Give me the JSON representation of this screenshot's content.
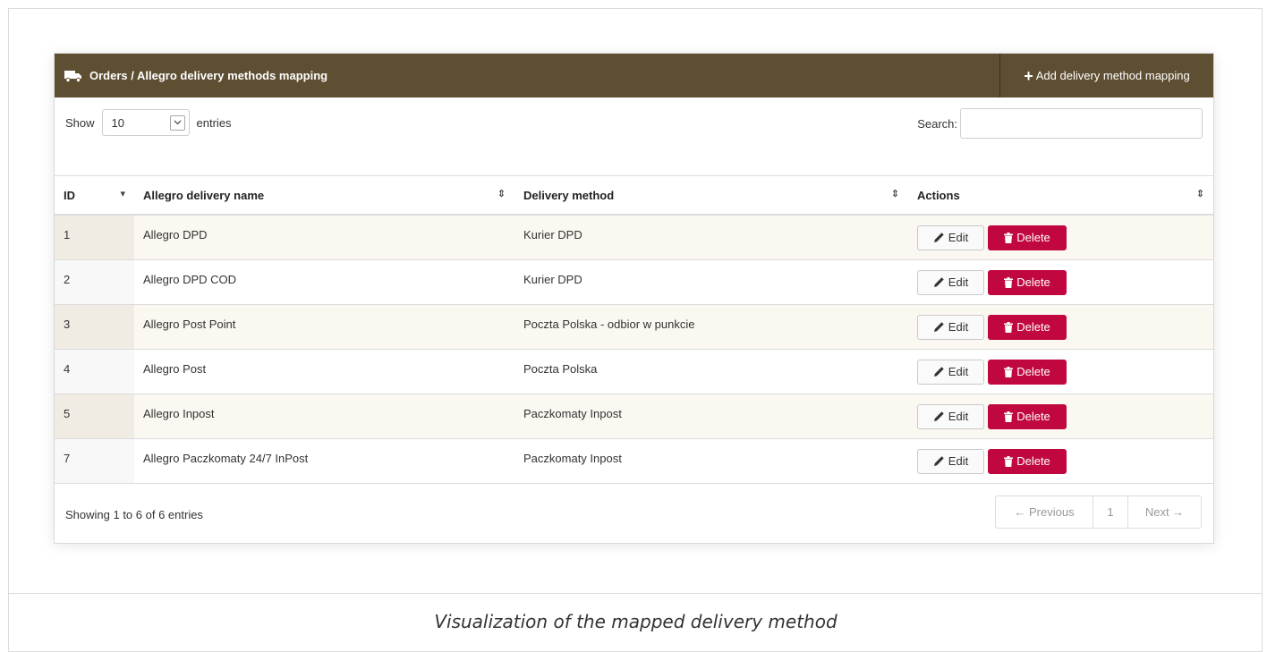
{
  "panel": {
    "title": "Orders / Allegro delivery methods mapping",
    "add_label": "Add delivery method mapping"
  },
  "controls": {
    "show_label": "Show",
    "page_size": "10",
    "entries_label": "entries",
    "search_label": "Search:",
    "search_value": ""
  },
  "table": {
    "headers": [
      "ID",
      "Allegro delivery name",
      "Delivery method",
      "Actions"
    ],
    "rows": [
      {
        "id": "1",
        "name": "Allegro DPD",
        "method": "Kurier DPD",
        "edit": "Edit",
        "delete": "Delete"
      },
      {
        "id": "2",
        "name": "Allegro DPD COD",
        "method": "Kurier DPD",
        "edit": "Edit",
        "delete": "Delete"
      },
      {
        "id": "3",
        "name": "Allegro Post Point",
        "method": "Poczta Polska - odbior w punkcie",
        "edit": "Edit",
        "delete": "Delete"
      },
      {
        "id": "4",
        "name": "Allegro Post",
        "method": "Poczta Polska",
        "edit": "Edit",
        "delete": "Delete"
      },
      {
        "id": "5",
        "name": "Allegro Inpost",
        "method": "Paczkomaty Inpost",
        "edit": "Edit",
        "delete": "Delete"
      },
      {
        "id": "7",
        "name": "Allegro Paczkomaty 24/7 InPost",
        "method": "Paczkomaty Inpost",
        "edit": "Edit",
        "delete": "Delete"
      }
    ]
  },
  "footer": {
    "info": "Showing 1 to 6 of 6 entries",
    "prev": "← Previous",
    "page": "1",
    "next": "Next →"
  },
  "caption": "Visualization of the mapped delivery method",
  "colors": {
    "header_bg": "#5e4e32",
    "delete_bg": "#c0073f",
    "odd_row_bg": "#fbf8f2"
  },
  "icons": {
    "title": "truck-icon",
    "add": "plus-icon",
    "edit": "pencil-icon",
    "delete": "trash-icon",
    "sort": "sort-icon"
  }
}
